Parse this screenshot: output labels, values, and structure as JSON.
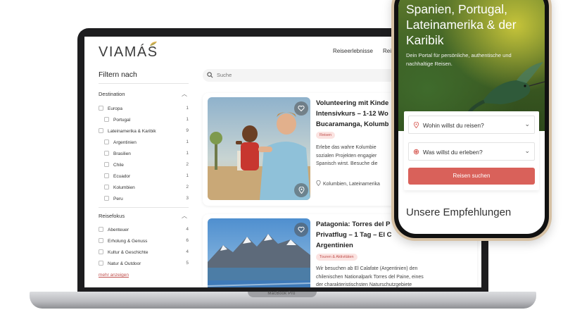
{
  "website": {
    "logo": "VIAMÁS",
    "nav": [
      "Reiseerlebnisse",
      "Reis"
    ],
    "search_placeholder": "Suche"
  },
  "sidebar": {
    "title": "Filtern nach",
    "groups": [
      {
        "label": "Destination",
        "options": [
          {
            "label": "Europa",
            "count": "1"
          },
          {
            "label": "Portugal",
            "count": "1"
          },
          {
            "label": "Lateinamerika & Karibik",
            "count": "9"
          },
          {
            "label": "Argentinien",
            "count": "1"
          },
          {
            "label": "Brasilien",
            "count": "1"
          },
          {
            "label": "Chile",
            "count": "2"
          },
          {
            "label": "Ecuador",
            "count": "1"
          },
          {
            "label": "Kolumbien",
            "count": "2"
          },
          {
            "label": "Peru",
            "count": "3"
          }
        ]
      },
      {
        "label": "Reisefokus",
        "options": [
          {
            "label": "Abenteuer",
            "count": "4"
          },
          {
            "label": "Erholung & Genuss",
            "count": "6"
          },
          {
            "label": "Kultur & Geschichte",
            "count": "4"
          },
          {
            "label": "Natur & Outdoor",
            "count": "5"
          }
        ]
      }
    ],
    "show_more": "mehr anzeigen"
  },
  "cards": [
    {
      "title_lines": [
        "Volunteering mit Kinde",
        "Intensivkurs – 1-12 Wo",
        "Bucaramanga, Kolumb"
      ],
      "tag": "Reisen",
      "desc_lines": [
        "Erlebe das wahre Kolumbie",
        "sozialen Projekten engagier",
        "Spanisch wirst. Besuche die"
      ],
      "location": "Kolumbien, Lateinamerika"
    },
    {
      "title_lines": [
        "Patagonia: Torres del P",
        "Privatflug – 1 Tag – El C",
        "Argentinien"
      ],
      "tag": "Touren & Aktivitäten",
      "desc_lines": [
        "Wir besuchen ab El Calafate (Argentinien) den",
        "chilenischen Nationalpark Torres del Paine, eines",
        "der charakteristischsten Naturschutzgebiete"
      ]
    }
  ],
  "laptop_brand": "MacBook Pro",
  "phone": {
    "hero_title": "Spanien, Portugal, Lateinamerika & der Karibik",
    "hero_subtitle": "Dein Portal für persönliche, authentische und nachhaltige Reisen.",
    "destination_select": "Wohin willst du reisen?",
    "experience_select": "Was willst du erleben?",
    "cta": "Reisen suchen",
    "recommendations": "Unsere Empfehlungen"
  },
  "colors": {
    "accent": "#d9615a",
    "tag_bg": "#fbe3e1",
    "phone_gold": "#d6c1a4"
  },
  "icons": [
    "search-icon",
    "heart-icon",
    "location-pin-icon",
    "chevron-down-icon",
    "chevron-up-icon",
    "star-icon"
  ]
}
